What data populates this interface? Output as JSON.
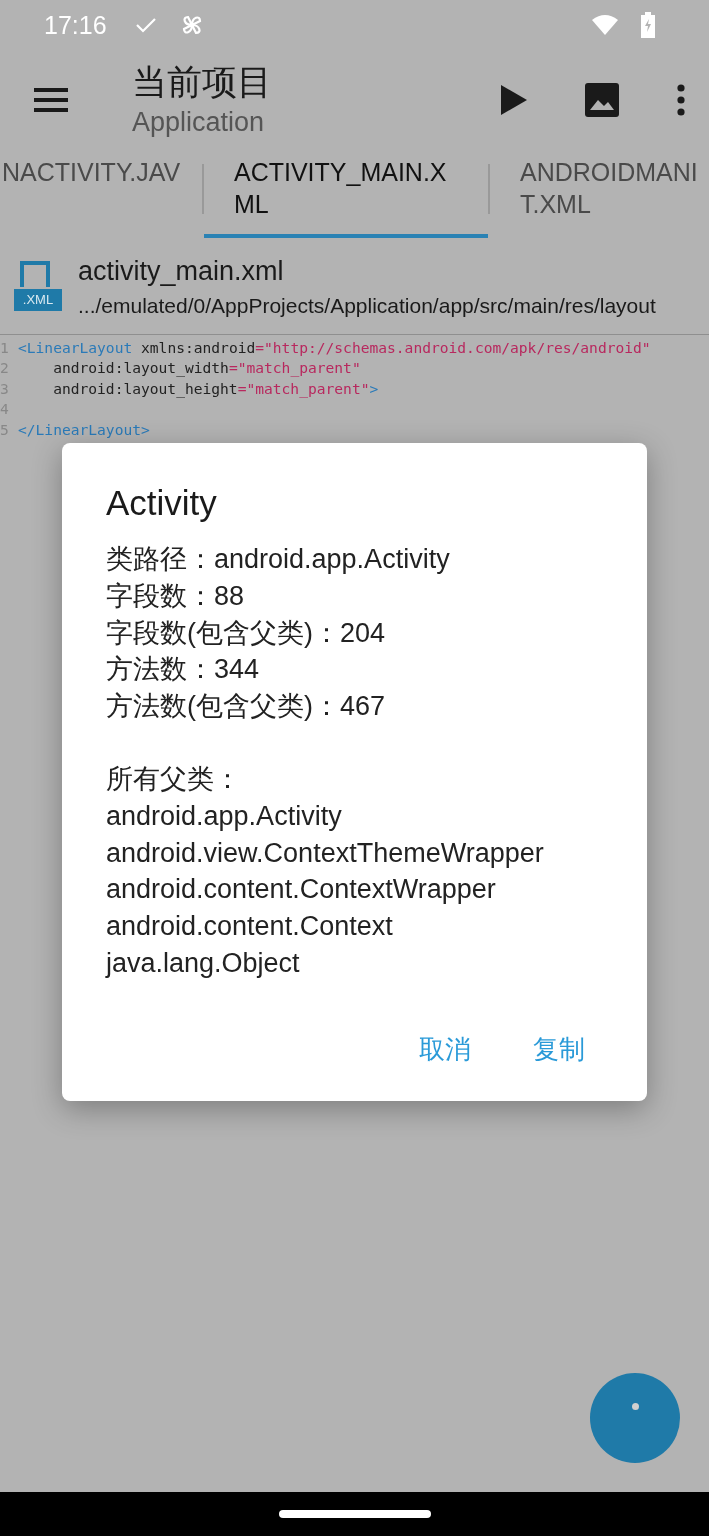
{
  "status_bar": {
    "time": "17:16"
  },
  "toolbar": {
    "title": "当前项目",
    "subtitle": "Application"
  },
  "tabs": [
    {
      "lines": [
        "NACTIVITY.JAV"
      ],
      "selected": false
    },
    {
      "lines": [
        "ACTIVITY_MAIN.X",
        "ML"
      ],
      "selected": true
    },
    {
      "lines": [
        "ANDROIDMANI",
        "T.XML"
      ],
      "selected": false
    }
  ],
  "file": {
    "badge": ".XML",
    "name": "activity_main.xml",
    "path": ".../emulated/0/AppProjects/Application/app/src/main/res/layout"
  },
  "code": [
    {
      "number": "1",
      "tokens": [
        {
          "kind": "tag",
          "text": "<LinearLayout"
        },
        {
          "kind": "attr",
          "text": " xmlns:android"
        },
        {
          "kind": "string",
          "text": "=\"http://schemas.android.com/apk/res/android\""
        }
      ]
    },
    {
      "number": "2",
      "tokens": [
        {
          "kind": "attr",
          "text": "    android:layout_width"
        },
        {
          "kind": "string",
          "text": "=\"match_parent\""
        }
      ]
    },
    {
      "number": "3",
      "tokens": [
        {
          "kind": "attr",
          "text": "    android:layout_height"
        },
        {
          "kind": "string",
          "text": "=\"match_parent\""
        },
        {
          "kind": "tag",
          "text": ">"
        }
      ]
    },
    {
      "number": "4"
    },
    {
      "number": "5",
      "tokens": [
        {
          "kind": "tag",
          "text": "</LinearLayout>"
        }
      ]
    }
  ],
  "dialog": {
    "title": "Activity",
    "stats": [
      "类路径：android.app.Activity",
      "字段数：88",
      "字段数(包含父类)：204",
      "方法数：344",
      "方法数(包含父类)：467"
    ],
    "superclasses_label": "所有父类：",
    "superclasses": [
      "android.app.Activity",
      "android.view.ContextThemeWrapper",
      "android.content.ContextWrapper",
      "android.content.Context",
      "java.lang.Object"
    ],
    "buttons": [
      "取消",
      "复制"
    ]
  }
}
